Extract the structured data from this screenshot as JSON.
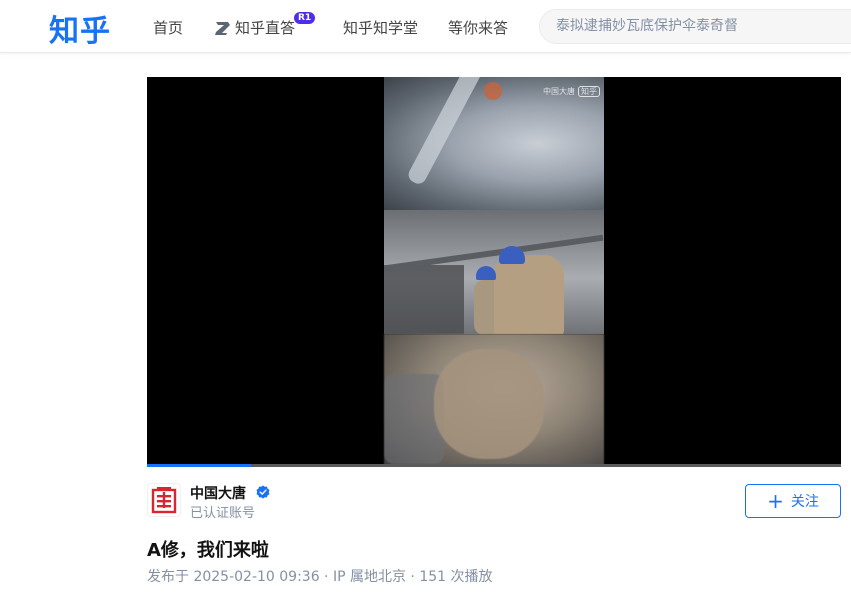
{
  "header": {
    "logo": "知乎",
    "nav": {
      "home": "首页",
      "zhida": "知乎直答",
      "zhida_badge": "R1",
      "xuetang": "知乎知学堂",
      "wait": "等你来答"
    },
    "search_placeholder": "泰拟逮捕妙瓦底保护伞泰奇督"
  },
  "video": {
    "watermark": "中国大唐",
    "watermark_tag": "知乎",
    "progress": 0.15
  },
  "author": {
    "name": "中国大唐",
    "subtitle": "已认证账号",
    "follow_label": "关注"
  },
  "post": {
    "title": "A修，我们来啦",
    "meta": "发布于 2025-02-10 09:36 · IP 属地北京 · 151 次播放"
  },
  "colors": {
    "brand": "#1772f6",
    "badge": "#4f2ee5",
    "avatar_logo": "#d7262f"
  },
  "icons": [
    "zhida-icon",
    "verified-icon",
    "plus-icon",
    "datang-logo"
  ]
}
